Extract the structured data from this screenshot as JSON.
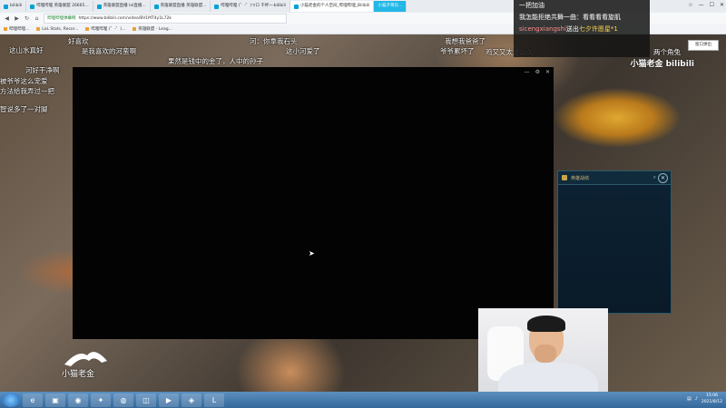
{
  "browser": {
    "tabs": [
      {
        "label": "bilibili",
        "active": false
      },
      {
        "label": "哔哩哔哩 英雄联盟 26665...",
        "active": false
      },
      {
        "label": "英雄联盟直播 lol直播...",
        "active": false
      },
      {
        "label": "英雄联盟直播 英雄联盟...",
        "active": false
      },
      {
        "label": "哔哩哔哩 (゜-゜)つロ 干杯~-bilibili",
        "active": false
      },
      {
        "label": "小猫老金的个人空间_哔哩哔哩_Bilibili",
        "active": true
      },
      {
        "label": "小猫子哥比...",
        "active": false,
        "highlight": true
      }
    ],
    "address": {
      "site_label": "哔哩哔哩弹幕网",
      "url": "https://www.bilibili.com/video/BV1MT4y1L72k"
    },
    "bookmarks": [
      "哔哩哔哩...",
      "LoL Stats, Recor...",
      "哔哩哔哩 (゜-゜)...",
      "英雄联盟 - Leag..."
    ]
  },
  "danmaku": [
    "这山水真好",
    "好喜欢",
    "是我喜欢的河蛮啊",
    "河：你拿我石头",
    "这小河爱了",
    "果然是钱中的金了，人中的孙子",
    "我想我爸爸了",
    "爷爷累坏了",
    "河好干净啊",
    "被爷爷这么宠爱",
    "方法给我弄过一把",
    "智说多了一对脚",
    "两个角兔",
    "鸡又又太这么久"
  ],
  "chat": {
    "lines": [
      {
        "text": "一把加油"
      },
      {
        "text": "我怎能拒绝共舞一曲：看看看看旋肌"
      },
      {
        "user": "sicengxiangshi",
        "action": "送出",
        "gift": "七夕许愿星*1"
      }
    ]
  },
  "watermark": {
    "title": "小猫老金",
    "brand": "bilibili"
  },
  "popout_label": "窗口弹出",
  "lol_panel": {
    "title": "英雄战绩"
  },
  "logo_text": "小猫老金",
  "taskbar": {
    "items": [
      "ie",
      "folder",
      "chrome",
      "xunlei",
      "qq",
      "tool",
      "video",
      "game",
      "lol"
    ],
    "clock_time": "15:06",
    "clock_date": "2021/8/12"
  },
  "colors": {
    "accent": "#00a1d6",
    "gift": "#ffd34d",
    "user": "#ff8a8a",
    "taskbar": "#35689a"
  }
}
